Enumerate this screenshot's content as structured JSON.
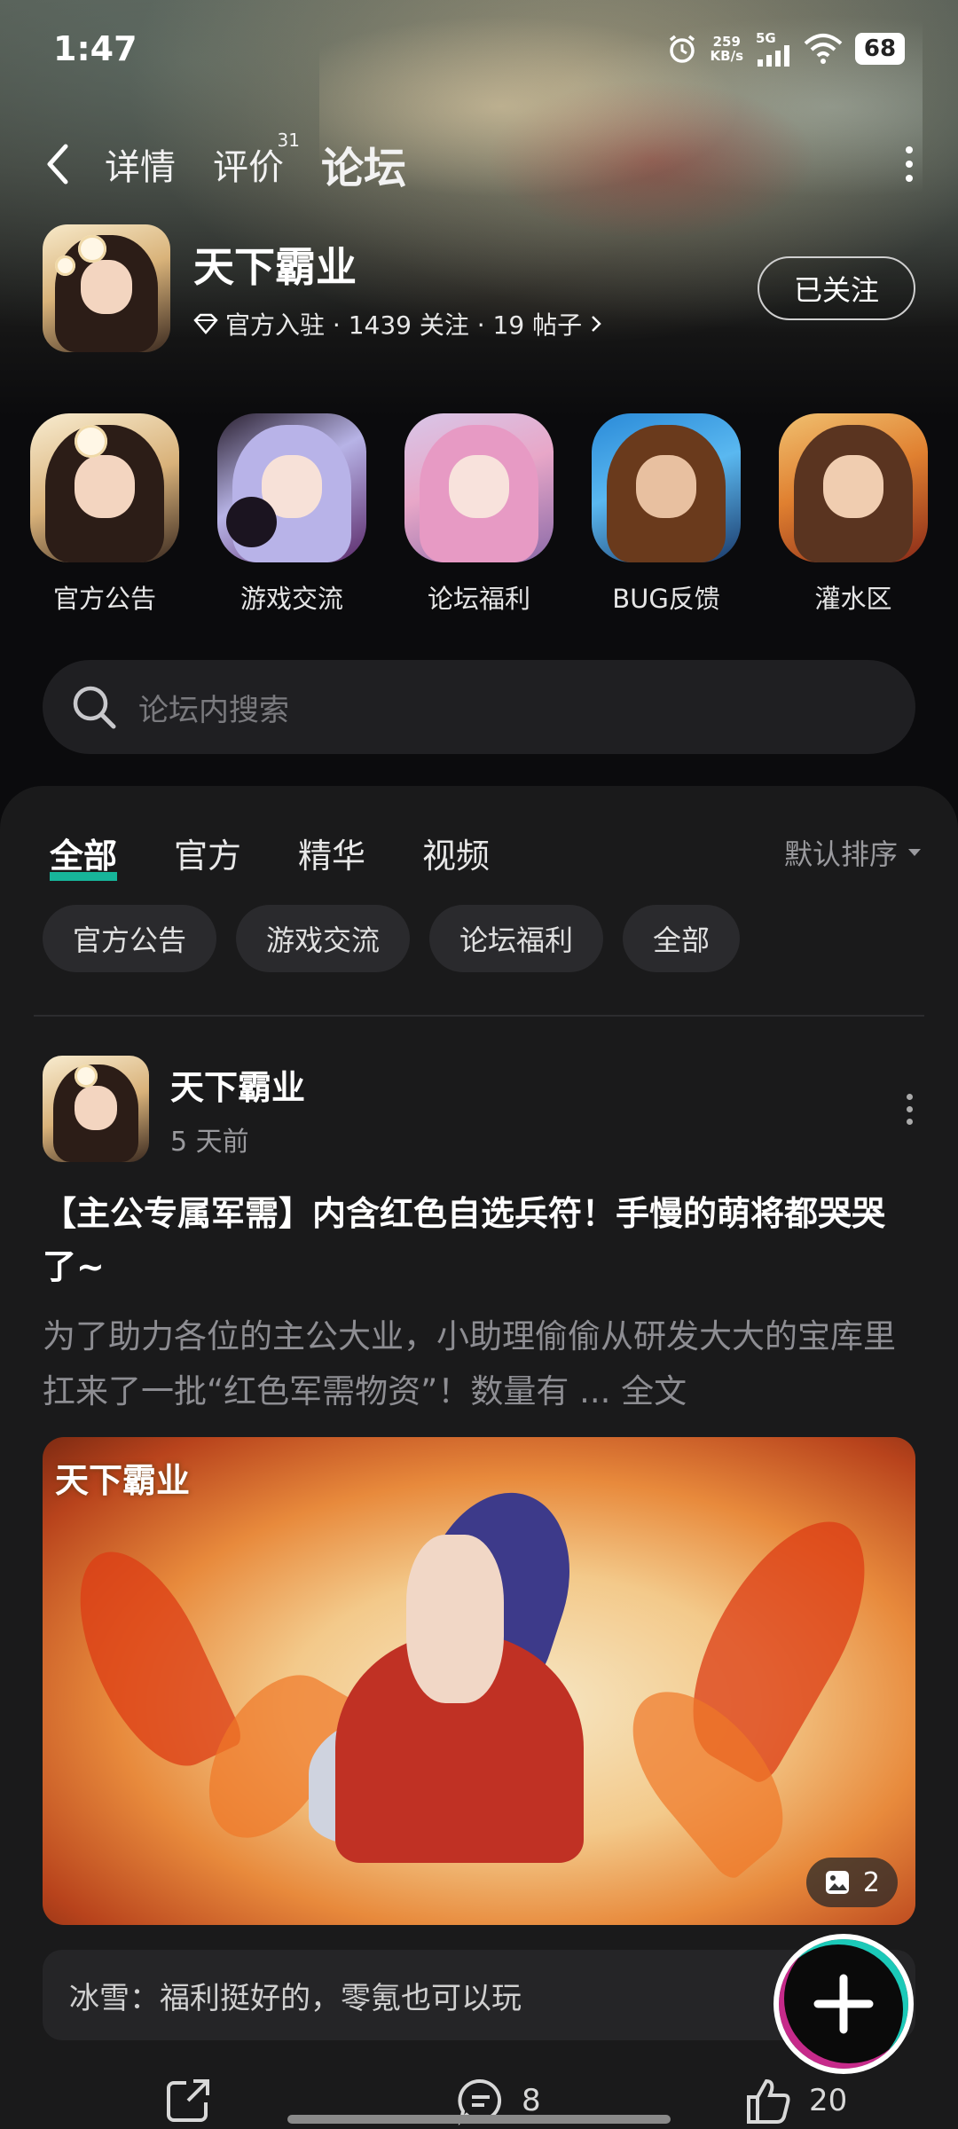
{
  "status_bar": {
    "time": "1:47",
    "net_speed": "259",
    "net_unit": "KB/s",
    "network_type": "5G",
    "battery": "68"
  },
  "nav": {
    "tabs": [
      {
        "label": "详情"
      },
      {
        "label": "评价",
        "badge": "31"
      },
      {
        "label": "论坛",
        "active": true
      }
    ],
    "accent_color": "#17c7a9"
  },
  "game": {
    "title": "天下霸业",
    "meta": "官方入驻 · 1439 关注 · 19 帖子",
    "follow_label": "已关注"
  },
  "channels": [
    {
      "label": "官方公告"
    },
    {
      "label": "游戏交流"
    },
    {
      "label": "论坛福利"
    },
    {
      "label": "BUG反馈"
    },
    {
      "label": "灌水区"
    }
  ],
  "search": {
    "placeholder": "论坛内搜索"
  },
  "feed": {
    "tabs": [
      "全部",
      "官方",
      "精华",
      "视频"
    ],
    "sort_label": "默认排序",
    "chips": [
      "官方公告",
      "游戏交流",
      "论坛福利",
      "全部"
    ]
  },
  "post": {
    "author": "天下霸业",
    "time": "5 天前",
    "title": "【主公专属军需】内含红色自选兵符！手慢的萌将都哭哭了~",
    "excerpt": "为了助力各位的主公大业，小助理偷偷从研发大大的宝库里扛来了一批“红色军需物资”！数量有 ...",
    "full_text_label": "全文",
    "image_logo": "天下霸业",
    "image_count": "2",
    "top_comment": "冰雪：福利挺好的，零氪也可以玩",
    "comment_count": "8",
    "like_count": "20"
  }
}
